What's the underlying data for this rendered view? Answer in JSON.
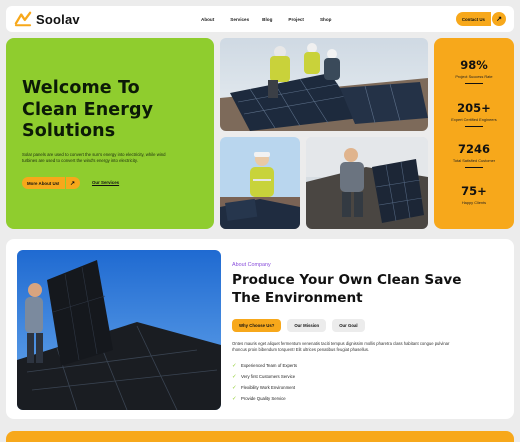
{
  "brand": {
    "name": "Soolav",
    "accent": "#f7a81b",
    "green": "#8fcd2e"
  },
  "nav": {
    "items": [
      "About",
      "Services",
      "Blog",
      "Project",
      "Shop"
    ],
    "cta": "Contact Us",
    "cta_icon": "arrow-up-right-icon"
  },
  "hero": {
    "title_lines": [
      "Welcome To",
      "Clean Energy",
      "Solutions"
    ],
    "description_lines": [
      "Solar panels are used to convert the sun's energy into electricity, while wind",
      "turbines are used to convert the wind's energy into electricity."
    ],
    "primary_button": "More About Us!",
    "secondary_link": "Our Services"
  },
  "stats": [
    {
      "value": "98%",
      "label": "Project Success Rate"
    },
    {
      "value": "205+",
      "label": "Expert Certified Engineers"
    },
    {
      "value": "7246",
      "label": "Total Satisfied Customer"
    },
    {
      "value": "75+",
      "label": "Happy Clients"
    }
  ],
  "about": {
    "tag": "About Company",
    "title_lines": [
      "Produce Your Own Clean Save",
      "The Environment"
    ],
    "tabs": [
      "Why Choose Us?",
      "Our Mission",
      "Our Goal"
    ],
    "active_tab": 0,
    "description_lines": [
      "Ontes mauris eget aliquet fermentum venenatis taciti tempus dignissim mollis pharetra class habitant congue pulvinar",
      "rhoncus proin bibendum torquent! Elit ultrices penatibus feugiat phasellus."
    ],
    "features": [
      "Experienced Team of Experts",
      "Very first Customers Service",
      "Flexibility Work Environment",
      "Provide Quality Service"
    ]
  }
}
